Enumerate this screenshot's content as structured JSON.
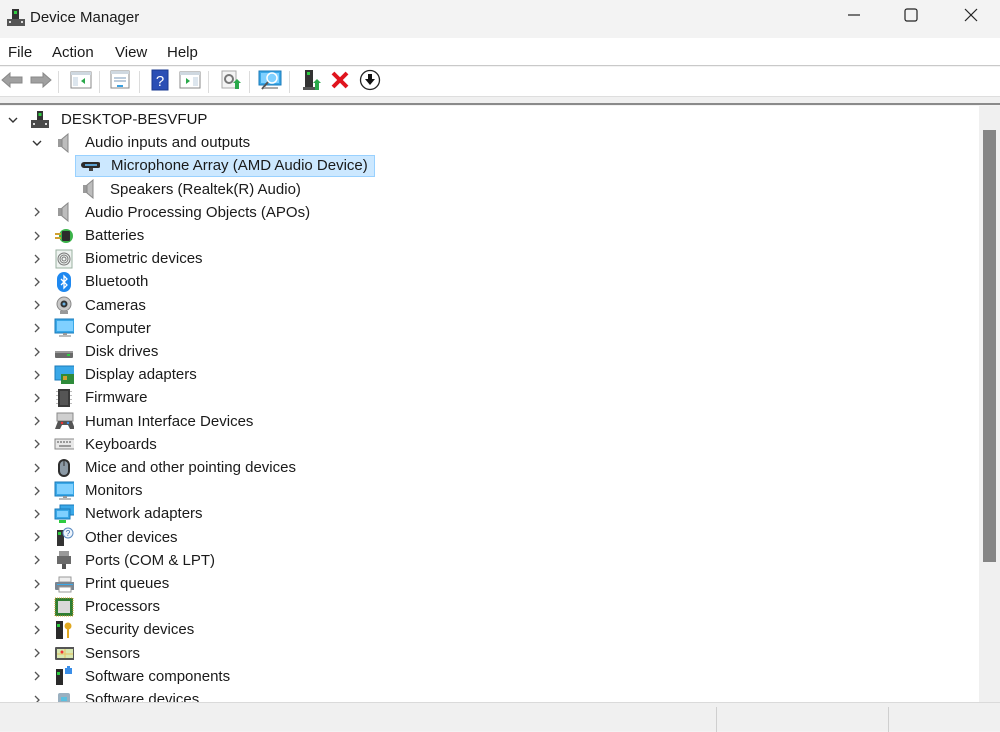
{
  "window": {
    "title": "Device Manager",
    "icon": "device-manager-icon",
    "controls": {
      "minimize": "minimize-icon",
      "maximize": "maximize-icon",
      "close": "close-icon"
    }
  },
  "menu": [
    "File",
    "Action",
    "View",
    "Help"
  ],
  "toolbar": [
    {
      "name": "back-button",
      "icon": "arrow-left-icon"
    },
    {
      "name": "forward-button",
      "icon": "arrow-right-icon"
    },
    {
      "name": "show-hide-console-tree-button",
      "icon": "console-tree-icon"
    },
    {
      "name": "properties-button",
      "icon": "properties-icon"
    },
    {
      "name": "help-button",
      "icon": "help-icon"
    },
    {
      "name": "show-hide-action-pane-button",
      "icon": "action-pane-icon"
    },
    {
      "name": "update-driver-button",
      "icon": "update-driver-icon"
    },
    {
      "name": "scan-hardware-changes-button",
      "icon": "scan-hardware-icon"
    },
    {
      "name": "enable-device-button",
      "icon": "enable-device-icon"
    },
    {
      "name": "uninstall-device-button",
      "icon": "uninstall-icon"
    },
    {
      "name": "disable-device-button",
      "icon": "disable-device-icon"
    }
  ],
  "tree": {
    "root": {
      "label": "DESKTOP-BESVFUP",
      "expanded": true,
      "icon": "computer-tower-icon"
    },
    "items": [
      {
        "label": "Audio inputs and outputs",
        "level": 1,
        "expanded": true,
        "icon": "speaker-icon"
      },
      {
        "label": "Microphone Array (AMD Audio Device)",
        "level": 2,
        "selected": true,
        "icon": "microphone-array-icon"
      },
      {
        "label": "Speakers (Realtek(R) Audio)",
        "level": 2,
        "icon": "speaker-icon"
      },
      {
        "label": "Audio Processing Objects (APOs)",
        "level": 1,
        "expanded": false,
        "icon": "speaker-icon"
      },
      {
        "label": "Batteries",
        "level": 1,
        "expanded": false,
        "icon": "battery-icon"
      },
      {
        "label": "Biometric devices",
        "level": 1,
        "expanded": false,
        "icon": "fingerprint-icon"
      },
      {
        "label": "Bluetooth",
        "level": 1,
        "expanded": false,
        "icon": "bluetooth-icon"
      },
      {
        "label": "Cameras",
        "level": 1,
        "expanded": false,
        "icon": "camera-icon"
      },
      {
        "label": "Computer",
        "level": 1,
        "expanded": false,
        "icon": "monitor-icon"
      },
      {
        "label": "Disk drives",
        "level": 1,
        "expanded": false,
        "icon": "disk-drive-icon"
      },
      {
        "label": "Display adapters",
        "level": 1,
        "expanded": false,
        "icon": "display-adapter-icon"
      },
      {
        "label": "Firmware",
        "level": 1,
        "expanded": false,
        "icon": "chip-icon"
      },
      {
        "label": "Human Interface Devices",
        "level": 1,
        "expanded": false,
        "icon": "hid-icon"
      },
      {
        "label": "Keyboards",
        "level": 1,
        "expanded": false,
        "icon": "keyboard-icon"
      },
      {
        "label": "Mice and other pointing devices",
        "level": 1,
        "expanded": false,
        "icon": "mouse-icon"
      },
      {
        "label": "Monitors",
        "level": 1,
        "expanded": false,
        "icon": "monitor-icon"
      },
      {
        "label": "Network adapters",
        "level": 1,
        "expanded": false,
        "icon": "network-adapter-icon"
      },
      {
        "label": "Other devices",
        "level": 1,
        "expanded": false,
        "icon": "unknown-device-icon"
      },
      {
        "label": "Ports (COM & LPT)",
        "level": 1,
        "expanded": false,
        "icon": "port-icon"
      },
      {
        "label": "Print queues",
        "level": 1,
        "expanded": false,
        "icon": "printer-icon"
      },
      {
        "label": "Processors",
        "level": 1,
        "expanded": false,
        "icon": "processor-icon"
      },
      {
        "label": "Security devices",
        "level": 1,
        "expanded": false,
        "icon": "security-key-icon"
      },
      {
        "label": "Sensors",
        "level": 1,
        "expanded": false,
        "icon": "sensor-icon"
      },
      {
        "label": "Software components",
        "level": 1,
        "expanded": false,
        "icon": "software-component-icon"
      },
      {
        "label": "Software devices",
        "level": 1,
        "expanded": false,
        "icon": "software-device-icon"
      }
    ]
  },
  "colors": {
    "selection_bg": "#cce8ff",
    "selection_border": "#99d1ff",
    "scroll_thumb": "#858585"
  },
  "scroll": {
    "position_fraction": 0.0,
    "visible_fraction": 0.75
  }
}
